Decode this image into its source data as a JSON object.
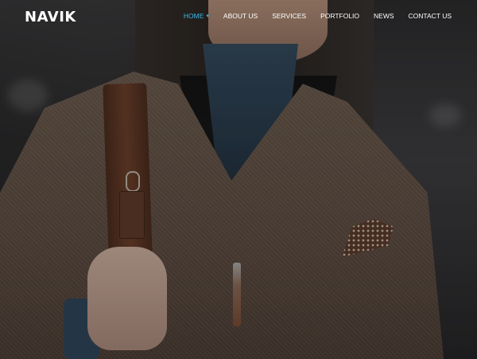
{
  "brand": {
    "logo": "NAVIK"
  },
  "nav": {
    "items": [
      {
        "label": "HOME",
        "active": true,
        "has_dropdown": true
      },
      {
        "label": "ABOUT US",
        "active": false
      },
      {
        "label": "SERVICES",
        "active": false
      },
      {
        "label": "PORTFOLIO",
        "active": false
      },
      {
        "label": "NEWS",
        "active": false
      },
      {
        "label": "CONTACT US",
        "active": false
      }
    ],
    "active_color": "#3cb8e6",
    "caret_icon": "chevron-down-icon"
  }
}
